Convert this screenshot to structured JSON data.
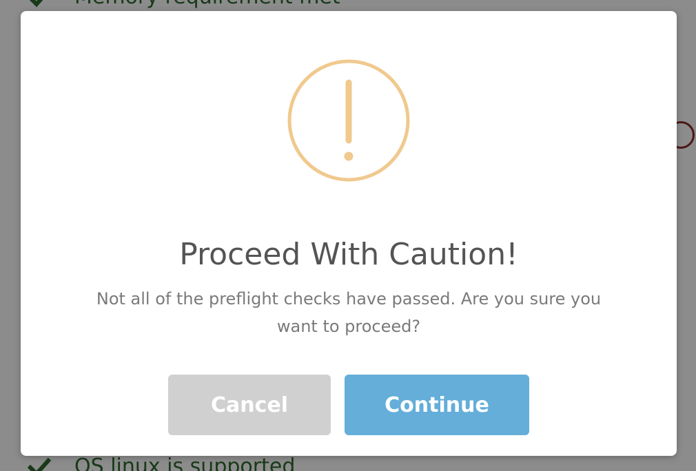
{
  "background": {
    "top_item": "Memory requirement met",
    "bottom_item": "OS linux is supported",
    "check_icon": "checkmark-icon",
    "check_color": "#2e6b2e"
  },
  "dialog": {
    "icon": "warning-exclamation-icon",
    "icon_color": "#f0c98e",
    "title": "Proceed With Caution!",
    "message": "Not all of the preflight checks have passed. Are you sure you want to proceed?",
    "cancel_label": "Cancel",
    "continue_label": "Continue",
    "cancel_color": "#d0d0d0",
    "continue_color": "#64aed9"
  }
}
